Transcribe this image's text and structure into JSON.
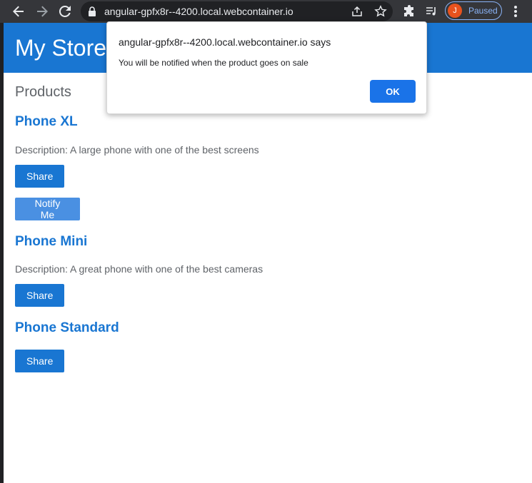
{
  "browser": {
    "url": "angular-gpfx8r--4200.local.webcontainer.io",
    "profile_initial": "J",
    "profile_status": "Paused"
  },
  "store": {
    "title": "My Store",
    "products_heading": "Products",
    "products": [
      {
        "name": "Phone XL",
        "description": "Description: A large phone with one of the best screens",
        "share_label": "Share",
        "notify_label": "Notify Me"
      },
      {
        "name": "Phone Mini",
        "description": "Description: A great phone with one of the best cameras",
        "share_label": "Share"
      },
      {
        "name": "Phone Standard",
        "share_label": "Share"
      }
    ]
  },
  "dialog": {
    "origin": "angular-gpfx8r--4200.local.webcontainer.io says",
    "message": "You will be notified when the product goes on sale",
    "ok_label": "OK"
  },
  "colors": {
    "primary": "#1976d2",
    "notify_button": "#4a90e2",
    "dialog_ok": "#1a73e8",
    "toolbar": "#35363a"
  }
}
